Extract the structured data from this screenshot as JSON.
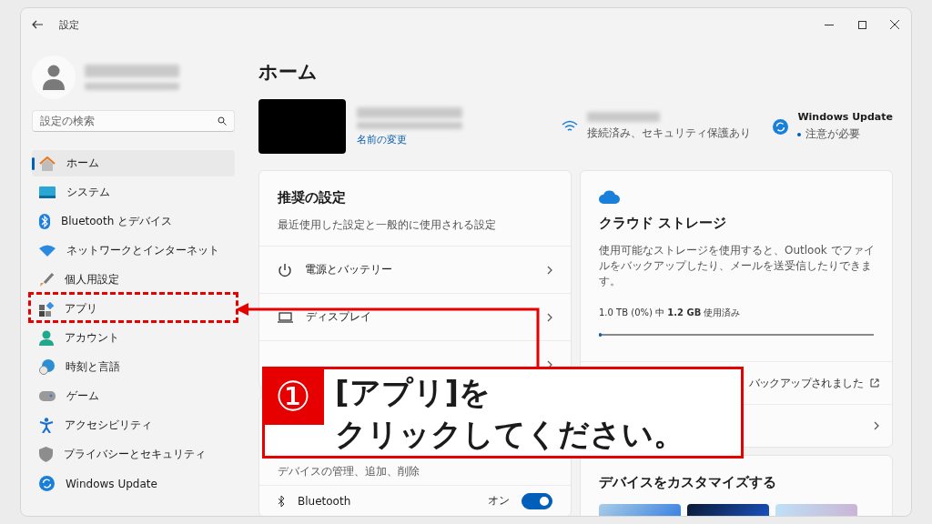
{
  "window": {
    "title": "設定"
  },
  "sidebar": {
    "search": {
      "placeholder": "設定の検索"
    },
    "items": [
      {
        "label": "ホーム",
        "kind": "home",
        "selected": true
      },
      {
        "label": "システム",
        "kind": "system",
        "selected": false
      },
      {
        "label": "Bluetooth とデバイス",
        "kind": "bluetooth",
        "selected": false
      },
      {
        "label": "ネットワークとインターネット",
        "kind": "network",
        "selected": false
      },
      {
        "label": "個人用設定",
        "kind": "brush",
        "selected": false
      },
      {
        "label": "アプリ",
        "kind": "apps",
        "selected": false
      },
      {
        "label": "アカウント",
        "kind": "account",
        "selected": false
      },
      {
        "label": "時刻と言語",
        "kind": "time",
        "selected": false
      },
      {
        "label": "ゲーム",
        "kind": "game",
        "selected": false
      },
      {
        "label": "アクセシビリティ",
        "kind": "access",
        "selected": false
      },
      {
        "label": "プライバシーとセキュリティ",
        "kind": "shield",
        "selected": false
      },
      {
        "label": "Windows Update",
        "kind": "update",
        "selected": false
      }
    ]
  },
  "main": {
    "title": "ホーム",
    "device": {
      "rename_link": "名前の変更"
    },
    "status": [
      {
        "kind": "wifi",
        "detail": "接続済み、セキュリティ保護あり"
      },
      {
        "kind": "update",
        "title": "Windows Update",
        "detail": "注意が必要",
        "attention": true
      }
    ]
  },
  "recommended": {
    "title": "推奨の設定",
    "subtitle": "最近使用した設定と一般的に使用される設定",
    "items": [
      {
        "kind": "power",
        "label": "電源とバッテリー"
      },
      {
        "kind": "display",
        "label": "ディスプレイ"
      },
      {
        "kind": "hidden"
      }
    ]
  },
  "bluetooth": {
    "subtitle": "デバイスの管理、追加、削除",
    "item": {
      "label": "Bluetooth",
      "state": "オン",
      "on": true
    }
  },
  "cloud": {
    "title": "クラウド ストレージ",
    "description": "使用可能なストレージを使用すると、Outlook でファイルをバックアップしたり、メールを送受信したりできます。",
    "usage": "1.0 TB (0%) 中 **1.2 GB** 使用済み",
    "level": 0.01,
    "rows": [
      {
        "value": "バックアップされました"
      },
      {}
    ]
  },
  "customize": {
    "title": "デバイスをカスタマイズする"
  },
  "callout": {
    "number": "①",
    "lines": [
      "[アプリ]を",
      "クリックしてください。"
    ]
  }
}
